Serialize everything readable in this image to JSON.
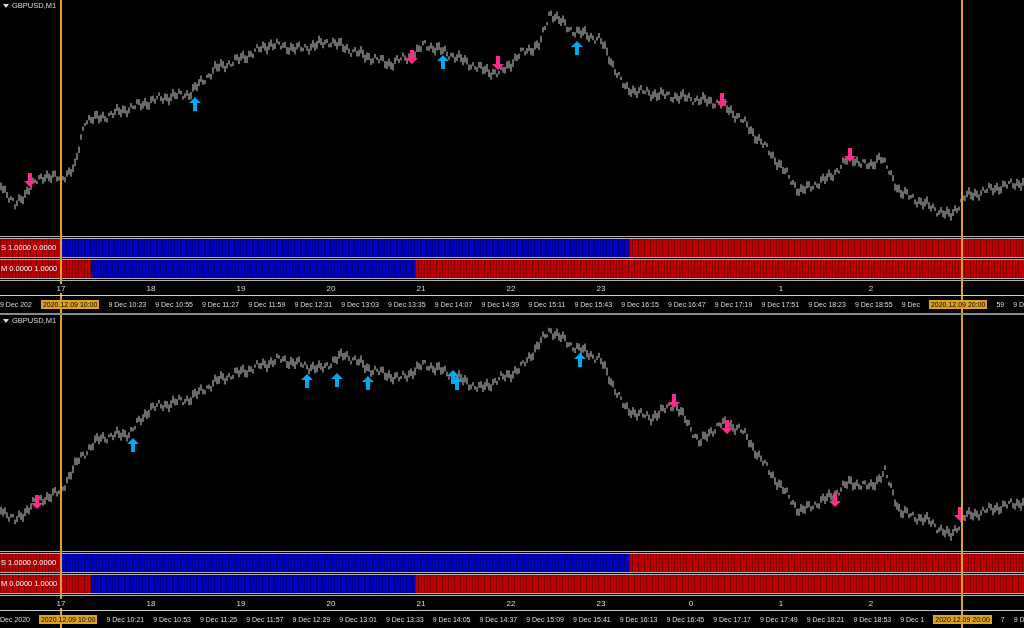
{
  "panels": [
    {
      "symbol": "GBPUSD,M1",
      "indicators": [
        {
          "label": "S 1.0000 0.0000"
        },
        {
          "label": "M 0.0000 1.0000"
        }
      ],
      "hours": [
        {
          "kind": "tick",
          "label": "17"
        },
        {
          "kind": "tick",
          "label": "18"
        },
        {
          "kind": "tick",
          "label": "19"
        },
        {
          "kind": "tick",
          "label": "20"
        },
        {
          "kind": "tick",
          "label": "21"
        },
        {
          "kind": "tick",
          "label": "22"
        },
        {
          "kind": "tick",
          "label": "23"
        },
        {
          "kind": "gap"
        },
        {
          "kind": "tick",
          "label": "1"
        },
        {
          "kind": "tick",
          "label": "2"
        }
      ],
      "time_labels": [
        {
          "text": "9 Dec 202",
          "highlighted": false
        },
        {
          "text": "2020.12.09 10:00",
          "highlighted": true
        },
        {
          "text": "9 Dec 10:23",
          "highlighted": false
        },
        {
          "text": "9 Dec 10:55",
          "highlighted": false
        },
        {
          "text": "9 Dec 11:27",
          "highlighted": false
        },
        {
          "text": "9 Dec 11:59",
          "highlighted": false
        },
        {
          "text": "9 Dec 12:31",
          "highlighted": false
        },
        {
          "text": "9 Dec 13:03",
          "highlighted": false
        },
        {
          "text": "9 Dec 13:35",
          "highlighted": false
        },
        {
          "text": "9 Dec 14:07",
          "highlighted": false
        },
        {
          "text": "9 Dec 14:39",
          "highlighted": false
        },
        {
          "text": "9 Dec 15:11",
          "highlighted": false
        },
        {
          "text": "9 Dec 15:43",
          "highlighted": false
        },
        {
          "text": "9 Dec 16:15",
          "highlighted": false
        },
        {
          "text": "9 Dec 16:47",
          "highlighted": false
        },
        {
          "text": "9 Dec 17:19",
          "highlighted": false
        },
        {
          "text": "9 Dec 17:51",
          "highlighted": false
        },
        {
          "text": "9 Dec 18:23",
          "highlighted": false
        },
        {
          "text": "9 Dec 18:55",
          "highlighted": false
        },
        {
          "text": "9 Dec",
          "highlighted": false
        },
        {
          "text": "2020.12.09 20:00",
          "highlighted": true
        },
        {
          "text": "59",
          "highlighted": false
        },
        {
          "text": "9 D",
          "highlighted": false
        }
      ]
    },
    {
      "symbol": "GBPUSD,M1",
      "indicators": [
        {
          "label": "S 1.0000 0.0000"
        },
        {
          "label": "M 0.0000 1.0000"
        }
      ],
      "hours": [
        {
          "kind": "tick",
          "label": "17"
        },
        {
          "kind": "tick",
          "label": "18"
        },
        {
          "kind": "tick",
          "label": "19"
        },
        {
          "kind": "tick",
          "label": "20"
        },
        {
          "kind": "tick",
          "label": "21"
        },
        {
          "kind": "tick",
          "label": "22"
        },
        {
          "kind": "tick",
          "label": "23"
        },
        {
          "kind": "tick",
          "label": "0"
        },
        {
          "kind": "tick",
          "label": "1"
        },
        {
          "kind": "tick",
          "label": "2"
        }
      ],
      "time_labels": [
        {
          "text": "Dec 2020",
          "highlighted": false
        },
        {
          "text": "2020.12.09 10:00",
          "highlighted": true
        },
        {
          "text": "9 Dec 10:21",
          "highlighted": false
        },
        {
          "text": "9 Dec 10:53",
          "highlighted": false
        },
        {
          "text": "9 Dec 11:25",
          "highlighted": false
        },
        {
          "text": "9 Dec 11:57",
          "highlighted": false
        },
        {
          "text": "9 Dec 12:29",
          "highlighted": false
        },
        {
          "text": "9 Dec 13:01",
          "highlighted": false
        },
        {
          "text": "9 Dec 13:33",
          "highlighted": false
        },
        {
          "text": "9 Dec 14:05",
          "highlighted": false
        },
        {
          "text": "9 Dec 14:37",
          "highlighted": false
        },
        {
          "text": "9 Dec 15:09",
          "highlighted": false
        },
        {
          "text": "9 Dec 15:41",
          "highlighted": false
        },
        {
          "text": "9 Dec 16:13",
          "highlighted": false
        },
        {
          "text": "9 Dec 16:45",
          "highlighted": false
        },
        {
          "text": "9 Dec 17:17",
          "highlighted": false
        },
        {
          "text": "9 Dec 17:49",
          "highlighted": false
        },
        {
          "text": "9 Dec 18:21",
          "highlighted": false
        },
        {
          "text": "9 Dec 18:53",
          "highlighted": false
        },
        {
          "text": "9 Dec 1",
          "highlighted": false
        },
        {
          "text": "2020.12.09 20:00",
          "highlighted": true
        },
        {
          "text": "7",
          "highlighted": false
        },
        {
          "text": "9 D",
          "highlighted": false
        }
      ]
    }
  ]
}
